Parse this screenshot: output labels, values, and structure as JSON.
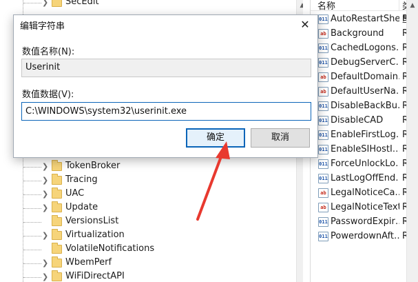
{
  "tree": {
    "partial_top_label": "SecEdit",
    "items": [
      {
        "label": "TokenBroker"
      },
      {
        "label": "Tracing"
      },
      {
        "label": "UAC"
      },
      {
        "label": "Update"
      },
      {
        "label": "VersionsList"
      },
      {
        "label": "Virtualization"
      },
      {
        "label": "VolatileNotifications"
      },
      {
        "label": "WbemPerf"
      },
      {
        "label": "WiFiDirectAPI"
      }
    ]
  },
  "values_list": {
    "header_name": "名称",
    "header_type": "类型",
    "rows": [
      {
        "icon": "dword-value-icon",
        "name": "AutoRestartShell",
        "type": "REG"
      },
      {
        "icon": "string-value-icon",
        "name": "Background",
        "type": "REG"
      },
      {
        "icon": "dword-value-icon",
        "name": "CachedLogons…",
        "type": "REG"
      },
      {
        "icon": "dword-value-icon",
        "name": "DebugServerC…",
        "type": "REG"
      },
      {
        "icon": "string-value-icon",
        "name": "DefaultDomain…",
        "type": "REG"
      },
      {
        "icon": "string-value-icon",
        "name": "DefaultUserNa…",
        "type": "REG"
      },
      {
        "icon": "dword-value-icon",
        "name": "DisableBackBu…",
        "type": "REG"
      },
      {
        "icon": "dword-value-icon",
        "name": "DisableCAD",
        "type": "REG"
      },
      {
        "icon": "dword-value-icon",
        "name": "EnableFirstLog…",
        "type": "REG"
      },
      {
        "icon": "dword-value-icon",
        "name": "EnableSIHostI…",
        "type": "REG"
      },
      {
        "icon": "dword-value-icon",
        "name": "ForceUnlockLo…",
        "type": "REG"
      },
      {
        "icon": "dword-value-icon",
        "name": "LastLogOffEnd…",
        "type": "REG"
      },
      {
        "icon": "string-value-icon",
        "name": "LegalNoticeCa…",
        "type": "REG"
      },
      {
        "icon": "string-value-icon",
        "name": "LegalNoticeText",
        "type": "REG"
      },
      {
        "icon": "dword-value-icon",
        "name": "PasswordExpir…",
        "type": "REG"
      },
      {
        "icon": "dword-value-icon",
        "name": "PowerdownAft…",
        "type": "REG"
      }
    ]
  },
  "dialog": {
    "title": "编辑字符串",
    "close_glyph": "✕",
    "value_name_label": "数值名称(N):",
    "value_name": "Userinit",
    "value_data_label": "数值数据(V):",
    "value_data": "C:\\WINDOWS\\system32\\userinit.exe",
    "ok_label": "确定",
    "cancel_label": "取消"
  },
  "colors": {
    "accent_border": "#0a64b8",
    "annotation_arrow": "#e8392f"
  }
}
